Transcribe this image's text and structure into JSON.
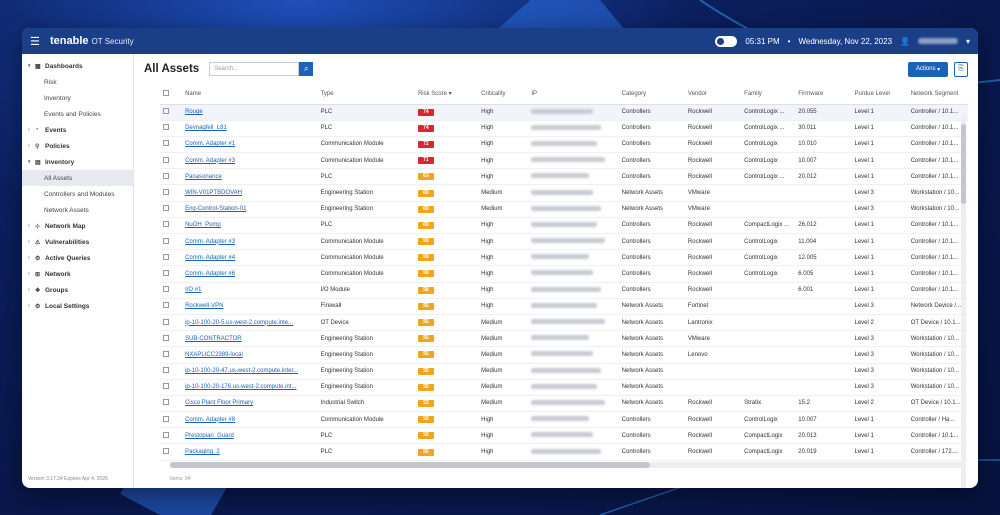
{
  "app": {
    "logo": "tenable",
    "product": "OT Security",
    "time": "05:31 PM",
    "date": "Wednesday, Nov 22, 2023"
  },
  "sidebar": {
    "items": [
      {
        "label": "Dashboards",
        "icon": "dashboard-icon",
        "expanded": true,
        "children": [
          "Risk",
          "Inventory",
          "Events and Policies"
        ]
      },
      {
        "label": "Events",
        "icon": "bell-icon"
      },
      {
        "label": "Policies",
        "icon": "policy-icon"
      },
      {
        "label": "Inventory",
        "icon": "inventory-icon",
        "expanded": true,
        "children": [
          "All Assets",
          "Controllers and Modules",
          "Network Assets"
        ]
      },
      {
        "label": "Network Map",
        "icon": "network-map-icon"
      },
      {
        "label": "Vulnerabilities",
        "icon": "vulnerability-icon"
      },
      {
        "label": "Active Queries",
        "icon": "query-icon"
      },
      {
        "label": "Network",
        "icon": "network-icon"
      },
      {
        "label": "Groups",
        "icon": "groups-icon"
      },
      {
        "label": "Local Settings",
        "icon": "settings-icon"
      }
    ],
    "active_child": "All Assets",
    "version": "Version 3.17.34 Expires Apr 4, 2026"
  },
  "main": {
    "title": "All Assets",
    "search_placeholder": "Search...",
    "actions_label": "Actions",
    "footer": "Items: 94"
  },
  "table": {
    "columns": [
      "Name",
      "Type",
      "Risk Score",
      "Criticality",
      "IP",
      "Category",
      "Vendor",
      "Family",
      "Firmware",
      "Purdue Level",
      "Network Segment"
    ],
    "rows": [
      {
        "name": "Rouge",
        "type": "PLC",
        "risk": "74",
        "risk_color": "#d9262e",
        "crit": "High",
        "cat": "Controllers",
        "vendor": "Rockwell",
        "family": "ControlLogix ...",
        "fw": "20.055",
        "purdue": "Level 1",
        "seg": "Controller / 10.1..."
      },
      {
        "name": "Devnagfell_L81",
        "type": "PLC",
        "risk": "74",
        "risk_color": "#d9262e",
        "crit": "High",
        "cat": "Controllers",
        "vendor": "Rockwell",
        "family": "ControlLogix ...",
        "fw": "30.011",
        "purdue": "Level 1",
        "seg": "Controller / 10.1..."
      },
      {
        "name": "Comm. Adapter #1",
        "type": "Communication Module",
        "risk": "72",
        "risk_color": "#d9262e",
        "crit": "High",
        "cat": "Controllers",
        "vendor": "Rockwell",
        "family": "ControlLogix",
        "fw": "10.010",
        "purdue": "Level 1",
        "seg": "Controller / 10.1..."
      },
      {
        "name": "Comm. Adapter #3",
        "type": "Communication Module",
        "risk": "71",
        "risk_color": "#d9262e",
        "crit": "High",
        "cat": "Controllers",
        "vendor": "Rockwell",
        "family": "ControlLogix",
        "fw": "10.007",
        "purdue": "Level 1",
        "seg": "Controller / 10.1..."
      },
      {
        "name": "Panasonance",
        "type": "PLC",
        "risk": "63",
        "risk_color": "#f0a61c",
        "crit": "High",
        "cat": "Controllers",
        "vendor": "Rockwell",
        "family": "ControlLogix ...",
        "fw": "20.012",
        "purdue": "Level 1",
        "seg": "Controller / 10.1..."
      },
      {
        "name": "WIN-V01PTBDOVAH",
        "type": "Engineering Station",
        "risk": "60",
        "risk_color": "#f0a61c",
        "crit": "Medium",
        "cat": "Network Assets",
        "vendor": "VMware",
        "family": "",
        "fw": "",
        "purdue": "Level 3",
        "seg": "Workstation / 10..."
      },
      {
        "name": "Eng-Control-Station-01",
        "type": "Engineering Station",
        "risk": "60",
        "risk_color": "#f0a61c",
        "crit": "Medium",
        "cat": "Network Assets",
        "vendor": "VMware",
        "family": "",
        "fw": "",
        "purdue": "Level 3",
        "seg": "Workstation / 10..."
      },
      {
        "name": "NuOH_Pump",
        "type": "PLC",
        "risk": "60",
        "risk_color": "#f0a61c",
        "crit": "High",
        "cat": "Controllers",
        "vendor": "Rockwell",
        "family": "CompactLogix ...",
        "fw": "26.012",
        "purdue": "Level 1",
        "seg": "Controller / 10.1..."
      },
      {
        "name": "Comm. Adapter #3",
        "type": "Communication Module",
        "risk": "59",
        "risk_color": "#f0a61c",
        "crit": "High",
        "cat": "Controllers",
        "vendor": "Rockwell",
        "family": "ControlLogix",
        "fw": "11.004",
        "purdue": "Level 1",
        "seg": "Controller / 10.1..."
      },
      {
        "name": "Comm. Adapter #4",
        "type": "Communication Module",
        "risk": "59",
        "risk_color": "#f0a61c",
        "crit": "High",
        "cat": "Controllers",
        "vendor": "Rockwell",
        "family": "ControlLogix",
        "fw": "12.005",
        "purdue": "Level 1",
        "seg": "Controller / 10.1..."
      },
      {
        "name": "Comm. Adapter #6",
        "type": "Communication Module",
        "risk": "59",
        "risk_color": "#f0a61c",
        "crit": "High",
        "cat": "Controllers",
        "vendor": "Rockwell",
        "family": "ControlLogix",
        "fw": "6.005",
        "purdue": "Level 1",
        "seg": "Controller / 10.1..."
      },
      {
        "name": "I/O #1",
        "type": "I/O Module",
        "risk": "58",
        "risk_color": "#f0a61c",
        "crit": "High",
        "cat": "Controllers",
        "vendor": "Rockwell",
        "family": "",
        "fw": "6.001",
        "purdue": "Level 1",
        "seg": "Controller / 10.1..."
      },
      {
        "name": "Rockwell-VPN",
        "type": "Firewall",
        "risk": "55",
        "risk_color": "#f0a61c",
        "crit": "High",
        "cat": "Network Assets",
        "vendor": "Fortinet",
        "family": "",
        "fw": "",
        "purdue": "Level 3",
        "seg": "Network Device /..."
      },
      {
        "name": "ip-10-100-20-5.us-west-2.compute.inte...",
        "type": "OT Device",
        "risk": "55",
        "risk_color": "#f0a61c",
        "crit": "Medium",
        "cat": "Network Assets",
        "vendor": "Lantronix",
        "family": "",
        "fw": "",
        "purdue": "Level 2",
        "seg": "OT Device / 10.1..."
      },
      {
        "name": "SUB-CONTRACTOR",
        "type": "Engineering Station",
        "risk": "55",
        "risk_color": "#f0a61c",
        "crit": "Medium",
        "cat": "Network Assets",
        "vendor": "VMware",
        "family": "",
        "fw": "",
        "purdue": "Level 3",
        "seg": "Workstation / 10..."
      },
      {
        "name": "NXAPLICC2389-local",
        "type": "Engineering Station",
        "risk": "55",
        "risk_color": "#f0a61c",
        "crit": "Medium",
        "cat": "Network Assets",
        "vendor": "Lenovo",
        "family": "",
        "fw": "",
        "purdue": "Level 3",
        "seg": "Workstation / 10..."
      },
      {
        "name": "ip-10-100-20-47.us-west-2.compute.inter...",
        "type": "Engineering Station",
        "risk": "55",
        "risk_color": "#f0a61c",
        "crit": "Medium",
        "cat": "Network Assets",
        "vendor": "",
        "family": "",
        "fw": "",
        "purdue": "Level 3",
        "seg": "Workstation / 10..."
      },
      {
        "name": "ip-10-100-20-176.us-west-2.compute.int...",
        "type": "Engineering Station",
        "risk": "55",
        "risk_color": "#f0a61c",
        "crit": "Medium",
        "cat": "Network Assets",
        "vendor": "",
        "family": "",
        "fw": "",
        "purdue": "Level 3",
        "seg": "Workstation / 10..."
      },
      {
        "name": "Cisco Plant Floor Primary",
        "type": "Industrial Switch",
        "risk": "53",
        "risk_color": "#f0a61c",
        "crit": "Medium",
        "cat": "Network Assets",
        "vendor": "Rockwell",
        "family": "Stratix",
        "fw": "15.2",
        "purdue": "Level 2",
        "seg": "OT Device / 10.1..."
      },
      {
        "name": "Comm. Adapter #8",
        "type": "Communication Module",
        "risk": "50",
        "risk_color": "#f0a61c",
        "crit": "High",
        "cat": "Controllers",
        "vendor": "Rockwell",
        "family": "ControlLogix",
        "fw": "10.007",
        "purdue": "Level 1",
        "seg": "Controller / Ha..."
      },
      {
        "name": "Prestopian_Guard",
        "type": "PLC",
        "risk": "50",
        "risk_color": "#f0a61c",
        "crit": "High",
        "cat": "Controllers",
        "vendor": "Rockwell",
        "family": "CompactLogix",
        "fw": "20.013",
        "purdue": "Level 1",
        "seg": "Controller / 10.1..."
      },
      {
        "name": "Packaging_2",
        "type": "PLC",
        "risk": "50",
        "risk_color": "#f0a61c",
        "crit": "High",
        "cat": "Controllers",
        "vendor": "Rockwell",
        "family": "CompactLogix",
        "fw": "20.019",
        "purdue": "Level 1",
        "seg": "Controller / 172...."
      }
    ]
  }
}
